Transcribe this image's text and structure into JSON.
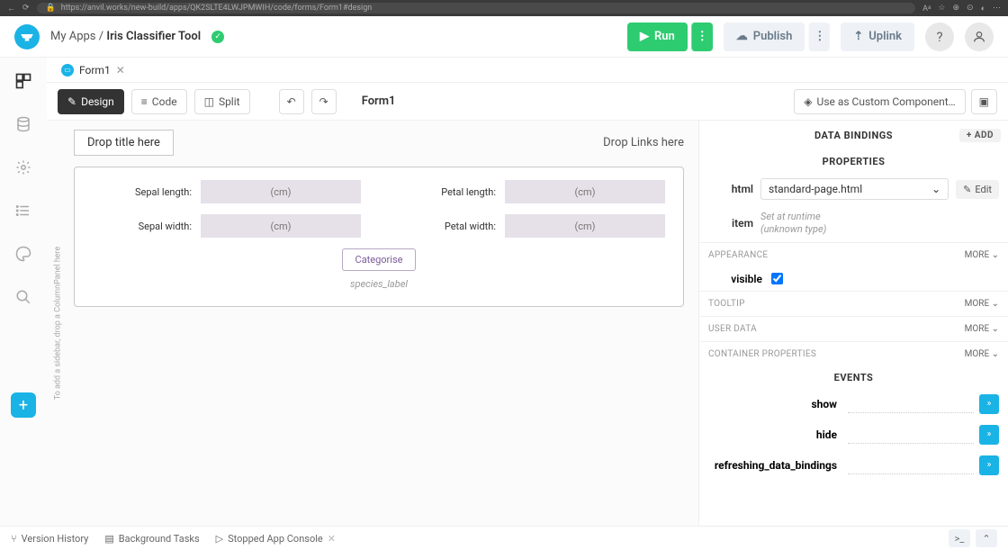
{
  "browser": {
    "url": "https://anvil.works/new-build/apps/QK2SLTE4LWJPMWIH/code/forms/Form1#design"
  },
  "header": {
    "breadcrumb_root": "My Apps",
    "breadcrumb_sep": " / ",
    "app_name": "Iris Classifier Tool",
    "run_label": "Run",
    "publish_label": "Publish",
    "uplink_label": "Uplink"
  },
  "tab": {
    "name": "Form1"
  },
  "toolbar": {
    "design": "Design",
    "code": "Code",
    "split": "Split",
    "form_title": "Form1",
    "custom_component": "Use as Custom Component…"
  },
  "canvas": {
    "drop_title": "Drop title here",
    "drop_links": "Drop Links here",
    "sidebar_hint": "To add a sidebar, drop a ColumnPanel here",
    "inputs": {
      "sepal_length_label": "Sepal length:",
      "sepal_width_label": "Sepal width:",
      "petal_length_label": "Petal length:",
      "petal_width_label": "Petal width:",
      "placeholder": "(cm)"
    },
    "categorise_btn": "Categorise",
    "species_label": "species_label"
  },
  "props": {
    "data_bindings": "DATA BINDINGS",
    "add": "ADD",
    "properties": "PROPERTIES",
    "html_label": "html",
    "html_value": "standard-page.html",
    "edit": "Edit",
    "item_label": "item",
    "item_value_line1": "Set at runtime",
    "item_value_line2": "(unknown type)",
    "appearance": "APPEARANCE",
    "visible_label": "visible",
    "tooltip": "TOOLTIP",
    "user_data": "USER DATA",
    "container_props": "CONTAINER PROPERTIES",
    "more": "MORE ⌄",
    "events": "EVENTS",
    "event_show": "show",
    "event_hide": "hide",
    "event_refresh": "refreshing_data_bindings"
  },
  "bottom": {
    "version_history": "Version History",
    "background_tasks": "Background Tasks",
    "console": "Stopped App Console"
  }
}
